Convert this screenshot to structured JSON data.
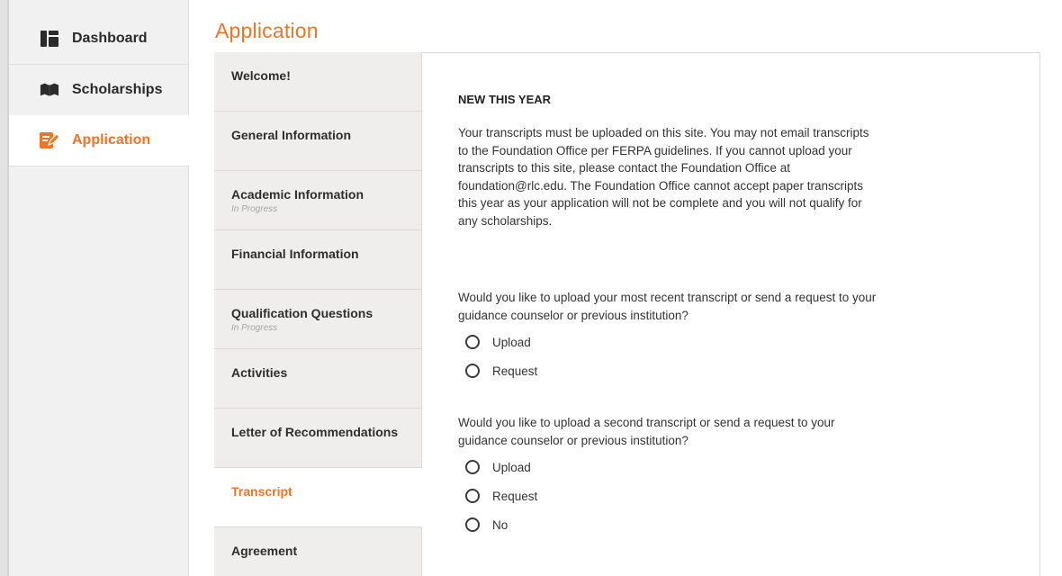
{
  "sidebar": {
    "items": [
      {
        "label": "Dashboard",
        "icon": "dashboard-icon",
        "active": false
      },
      {
        "label": "Scholarships",
        "icon": "open-book-icon",
        "active": false
      },
      {
        "label": "Application",
        "icon": "edit-form-icon",
        "active": true
      }
    ]
  },
  "page": {
    "title": "Application"
  },
  "steps": [
    {
      "label": "Welcome!",
      "status": ""
    },
    {
      "label": "General Information",
      "status": ""
    },
    {
      "label": "Academic Information",
      "status": "In Progress"
    },
    {
      "label": "Financial Information",
      "status": ""
    },
    {
      "label": "Qualification Questions",
      "status": "In Progress"
    },
    {
      "label": "Activities",
      "status": ""
    },
    {
      "label": "Letter of Recommendations",
      "status": ""
    },
    {
      "label": "Transcript",
      "status": "",
      "active": true
    },
    {
      "label": "Agreement",
      "status": ""
    }
  ],
  "content": {
    "section_title": "NEW THIS YEAR",
    "notice": "Your transcripts must be uploaded on this site. You may not email transcripts to the Foundation Office per FERPA guidelines. If you cannot upload your transcripts to this site, please contact the Foundation Office at foundation@rlc.edu. The Foundation Office cannot accept paper transcripts this year as your application will not be complete and you will not qualify for any scholarships.",
    "question1": {
      "text": "Would you like to upload your most recent transcript or send a request to your guidance counselor or previous institution?",
      "options": [
        "Upload",
        "Request"
      ]
    },
    "question2": {
      "text": "Would you like to upload a second transcript or send a request to your guidance counselor or previous institution?",
      "options": [
        "Upload",
        "Request",
        "No"
      ]
    }
  },
  "colors": {
    "accent": "#e8762b",
    "step_bg": "#f0eeed",
    "nav_bg": "#f1f1f1"
  }
}
